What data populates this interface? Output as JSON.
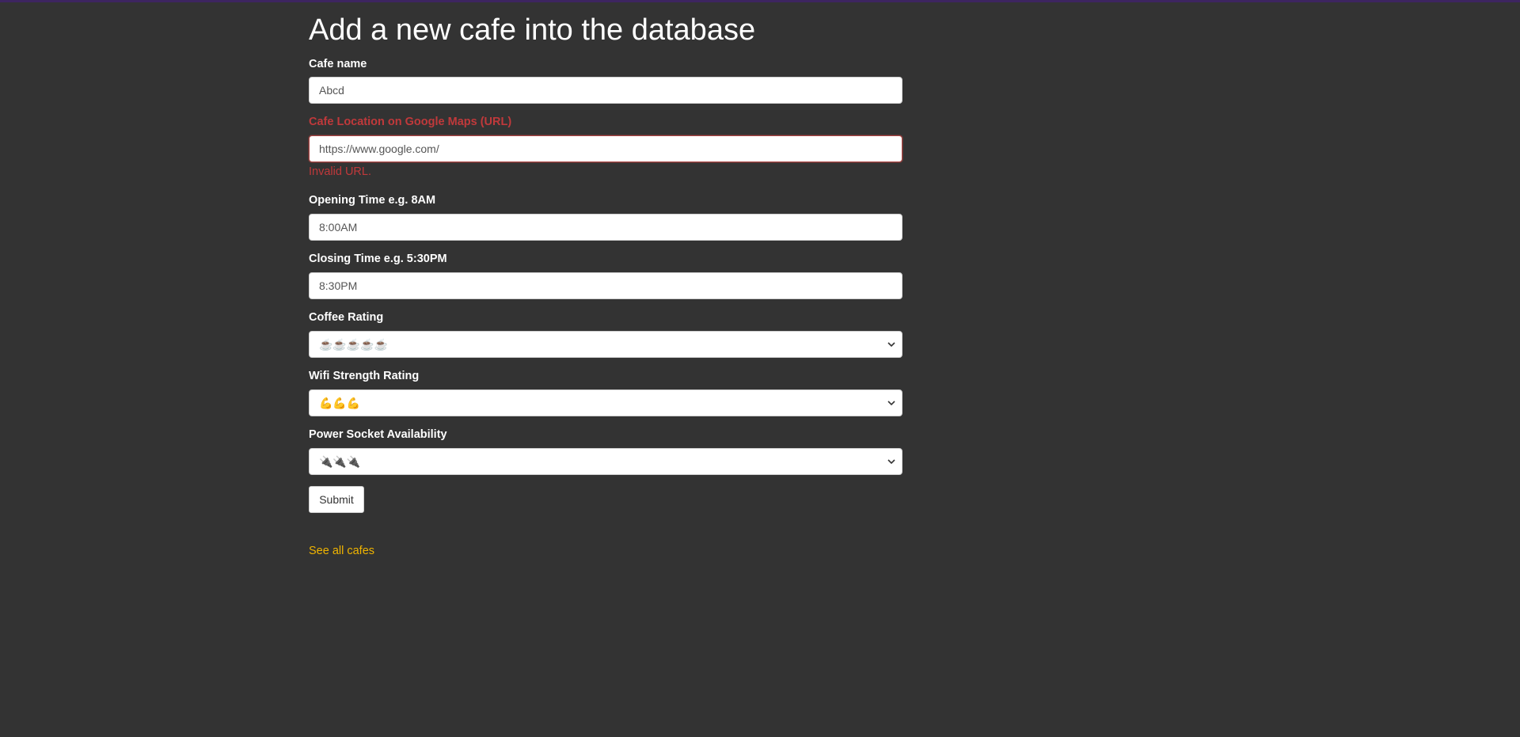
{
  "page": {
    "heading": "Add a new cafe into the database"
  },
  "form": {
    "cafe_name": {
      "label": "Cafe name",
      "value": "Abcd"
    },
    "location": {
      "label": "Cafe Location on Google Maps (URL)",
      "value": "https://www.google.com/",
      "error": "Invalid URL."
    },
    "opening_time": {
      "label": "Opening Time e.g. 8AM",
      "value": "8:00AM"
    },
    "closing_time": {
      "label": "Closing Time e.g. 5:30PM",
      "value": "8:30PM"
    },
    "coffee_rating": {
      "label": "Coffee Rating",
      "selected": "☕☕☕☕☕"
    },
    "wifi_rating": {
      "label": "Wifi Strength Rating",
      "selected": "💪💪💪"
    },
    "power_rating": {
      "label": "Power Socket Availability",
      "selected": "🔌🔌🔌"
    },
    "submit_label": "Submit"
  },
  "links": {
    "see_all": "See all cafes"
  },
  "colors": {
    "background": "#333333",
    "error": "#c0393b",
    "link": "#f0b400",
    "top_accent": "#3d2560"
  },
  "icons": {
    "select_arrow": "chevron-down-icon"
  }
}
